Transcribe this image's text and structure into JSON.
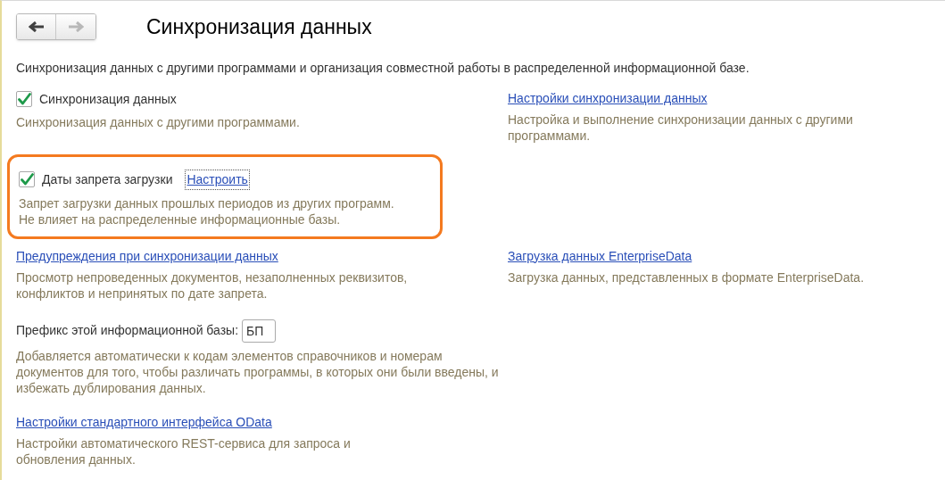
{
  "nav_buttons": [
    {
      "kind": "back",
      "disabled": false
    },
    {
      "kind": "forward",
      "disabled": true
    }
  ],
  "title": "Синхронизация данных",
  "intro": "Синхронизация данных с другими программами и организация совместной работы в распределенной информационной базе.",
  "sync_option": {
    "label": "Синхронизация данных",
    "checked": true,
    "description": "Синхронизация данных с другими программами."
  },
  "sync_settings": {
    "link": "Настройки синхронизации данных",
    "description": "Настройка и выполнение синхронизации данных с другими программами."
  },
  "import_bans": {
    "label": "Даты запрета загрузки",
    "checked": true,
    "link": "Настроить",
    "highlighted": true,
    "description": "Запрет загрузки данных прошлых периодов из других программ.\nНе влияет на распределенные информационные базы."
  },
  "sync_warnings": {
    "link": "Предупреждения при синхронизации данных",
    "description": "Просмотр непроведенных документов, незаполненных реквизитов, конфликтов и непринятых по дате запрета."
  },
  "enterprise_data": {
    "link": "Загрузка данных EnterpriseData",
    "description": "Загрузка данных, представленных в формате EnterpriseData."
  },
  "prefix": {
    "label": "Префикс этой информационной базы:",
    "value": "БП",
    "description": "Добавляется автоматически к кодам элементов справочников и номерам документов для того, чтобы различать программы, в которых они были введены, и избежать дублирования данных."
  },
  "odata": {
    "link": "Настройки стандартного интерфейса OData",
    "description": "Настройки автоматического REST-сервиса для запроса и обновления данных."
  }
}
